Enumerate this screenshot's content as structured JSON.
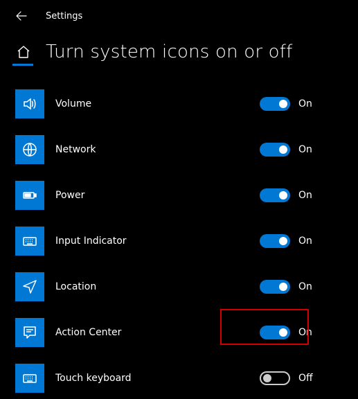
{
  "app_title": "Settings",
  "page_title": "Turn system icons on or off",
  "state_labels": {
    "on": "On",
    "off": "Off"
  },
  "items": [
    {
      "key": "volume",
      "label": "Volume",
      "state": "on",
      "icon": "volume-icon"
    },
    {
      "key": "network",
      "label": "Network",
      "state": "on",
      "icon": "network-icon"
    },
    {
      "key": "power",
      "label": "Power",
      "state": "on",
      "icon": "power-icon"
    },
    {
      "key": "input-indicator",
      "label": "Input Indicator",
      "state": "on",
      "icon": "keyboard-icon"
    },
    {
      "key": "location",
      "label": "Location",
      "state": "on",
      "icon": "location-icon"
    },
    {
      "key": "action-center",
      "label": "Action Center",
      "state": "on",
      "icon": "action-center-icon",
      "highlight": true
    },
    {
      "key": "touch-keyboard",
      "label": "Touch keyboard",
      "state": "off",
      "icon": "keyboard-icon"
    }
  ]
}
